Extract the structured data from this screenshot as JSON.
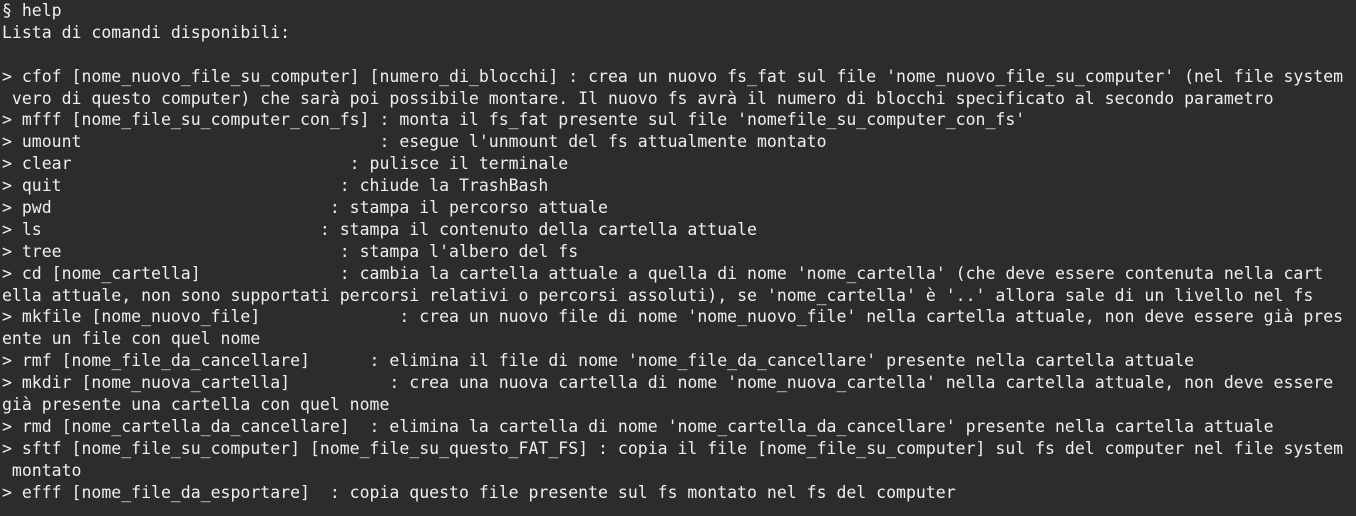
{
  "terminal": {
    "colors": {
      "background": "#2c2c2c",
      "foreground": "#efefef"
    },
    "lines": [
      "§ help",
      "Lista di comandi disponibili:",
      "",
      "> cfof [nome_nuovo_file_su_computer] [numero_di_blocchi] : crea un nuovo fs_fat sul file 'nome_nuovo_file_su_computer' (nel file system",
      " vero di questo computer) che sarà poi possibile montare. Il nuovo fs avrà il numero di blocchi specificato al secondo parametro",
      "> mfff [nome_file_su_computer_con_fs] : monta il fs_fat presente sul file 'nomefile_su_computer_con_fs'",
      "> umount                              : esegue l'unmount del fs attualmente montato",
      "> clear                            : pulisce il terminale",
      "> quit                            : chiude la TrashBash",
      "> pwd                            : stampa il percorso attuale",
      "> ls                            : stampa il contenuto della cartella attuale",
      "> tree                            : stampa l'albero del fs",
      "> cd [nome_cartella]              : cambia la cartella attuale a quella di nome 'nome_cartella' (che deve essere contenuta nella cart",
      "ella attuale, non sono supportati percorsi relativi o percorsi assoluti), se 'nome_cartella' è '..' allora sale di un livello nel fs",
      "> mkfile [nome_nuovo_file]              : crea un nuovo file di nome 'nome_nuovo_file' nella cartella attuale, non deve essere già pres",
      "ente un file con quel nome",
      "> rmf [nome_file_da_cancellare]      : elimina il file di nome 'nome_file_da_cancellare' presente nella cartella attuale",
      "> mkdir [nome_nuova_cartella]          : crea una nuova cartella di nome 'nome_nuova_cartella' nella cartella attuale, non deve essere",
      "già presente una cartella con quel nome",
      "> rmd [nome_cartella_da_cancellare]  : elimina la cartella di nome 'nome_cartella_da_cancellare' presente nella cartella attuale",
      "> sftf [nome_file_su_computer] [nome_file_su_questo_FAT_FS] : copia il file [nome_file_su_computer] sul fs del computer nel file system",
      " montato",
      "> efff [nome_file_da_esportare]  : copia questo file presente sul fs montato nel fs del computer"
    ]
  }
}
